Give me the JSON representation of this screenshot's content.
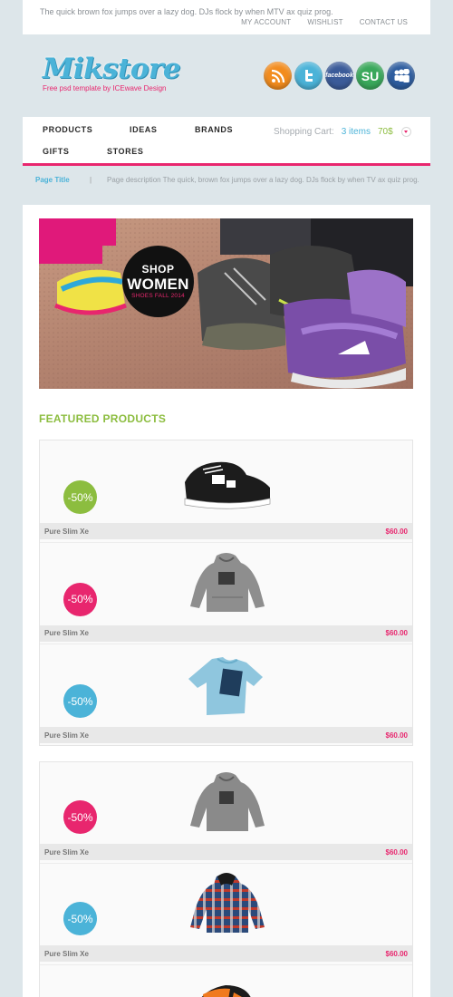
{
  "header": {
    "tagline": "The quick brown fox jumps over a lazy dog. DJs flock by when MTV ax quiz prog.",
    "links": [
      "MY ACCOUNT",
      "WISHLIST",
      "CONTACT US"
    ]
  },
  "logo": {
    "name": "Mikstore",
    "subtitle": "Free psd template by ICEwave Design"
  },
  "social": [
    {
      "icon": "rss-icon",
      "color": "#f28c1e"
    },
    {
      "icon": "twitter-icon",
      "color": "#4bb3d8"
    },
    {
      "icon": "facebook-icon",
      "label": "facebook",
      "color": "#3b5b99"
    },
    {
      "icon": "stumbleupon-icon",
      "label": "SU",
      "color": "#3aa85b"
    },
    {
      "icon": "myspace-icon",
      "color": "#2e5d9f"
    }
  ],
  "nav": {
    "items": [
      "PRODUCTS",
      "IDEAS",
      "BRANDS",
      "GIFTS",
      "STORES"
    ]
  },
  "cart": {
    "label": "Shopping Cart:",
    "items": "3 items",
    "total": "70$"
  },
  "page": {
    "title": "Page Title",
    "separator": "|",
    "description": "Page description The quick, brown fox jumps over a lazy dog. DJs flock by when TV ax quiz prog."
  },
  "banner": {
    "line1": "SHOP",
    "line2": "WOMEN",
    "line3": "SHOES FALL 2014"
  },
  "featured": {
    "title": "FEATURED PRODUCTS"
  },
  "products": [
    {
      "name": "Pure Slim Xe",
      "price": "$60.00",
      "discount": "-50%",
      "badge_color": "#8cbd3f",
      "image": "sneaker-black"
    },
    {
      "name": "Pure Slim Xe",
      "price": "$60.00",
      "discount": "-50%",
      "badge_color": "#e8266e",
      "image": "hoodie-grey"
    },
    {
      "name": "Pure Slim Xe",
      "price": "$60.00",
      "discount": "-50%",
      "badge_color": "#4bb3d8",
      "image": "tshirt-blue"
    },
    {
      "name": "Pure Slim Xe",
      "price": "$60.00",
      "discount": "-50%",
      "badge_color": "#e8266e",
      "image": "hoodie-grey"
    },
    {
      "name": "Pure Slim Xe",
      "price": "$60.00",
      "discount": "-50%",
      "badge_color": "#4bb3d8",
      "image": "hoodie-plaid"
    },
    {
      "image": "sneaker-orange"
    }
  ],
  "colors": {
    "accent_pink": "#e8266e",
    "accent_blue": "#4bb3d8",
    "accent_green": "#8cbd3f"
  }
}
